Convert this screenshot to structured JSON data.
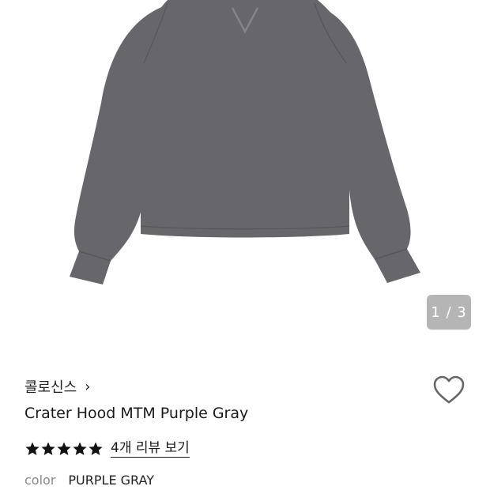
{
  "image_viewer": {
    "counter": "1 / 3",
    "current": 1,
    "total": 3,
    "garment_color": "#67666b"
  },
  "product": {
    "brand": "콜로신스",
    "brand_chevron": "›",
    "title": "Crater Hood MTM Purple Gray",
    "rating": 5,
    "rating_max": 5,
    "review_link": "4개 리뷰 보기",
    "option_label": "color",
    "option_value": "PURPLE GRAY"
  },
  "icons": {
    "wishlist": "heart-outline-icon",
    "star": "star-filled-icon"
  },
  "colors": {
    "text": "#1a1a1a",
    "muted": "#888888",
    "star": "#111111"
  }
}
